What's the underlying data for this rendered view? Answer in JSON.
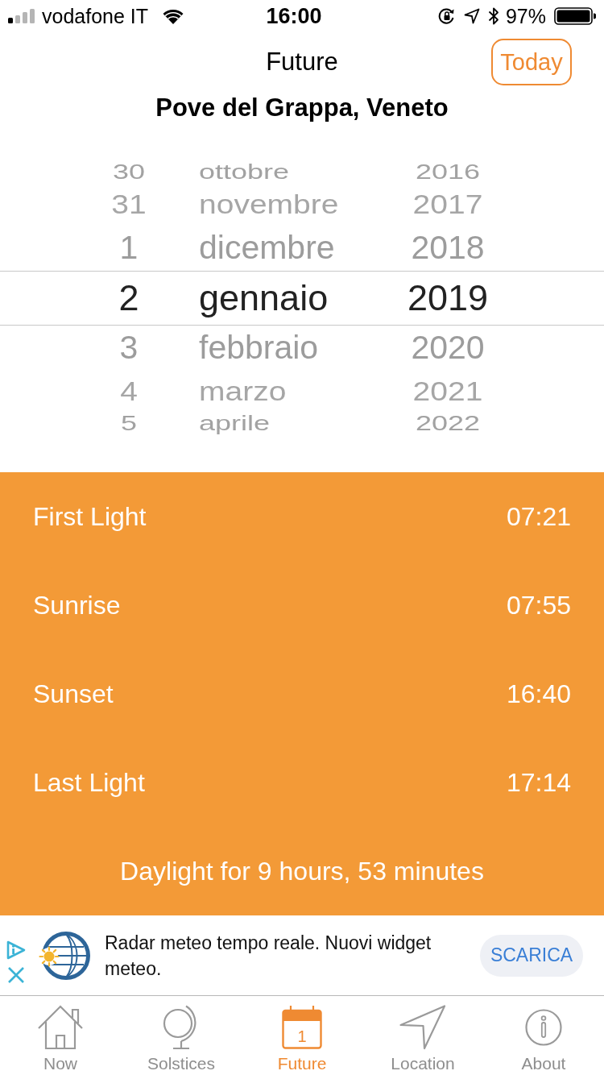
{
  "status_bar": {
    "carrier": "vodafone IT",
    "time": "16:00",
    "battery_percent": "97%"
  },
  "nav": {
    "title": "Future",
    "today_button": "Today"
  },
  "location": "Pove del Grappa, Veneto",
  "date_picker": {
    "rows": [
      {
        "day": "30",
        "month": "ottobre",
        "year": "2016",
        "selected": false
      },
      {
        "day": "31",
        "month": "novembre",
        "year": "2017",
        "selected": false
      },
      {
        "day": "1",
        "month": "dicembre",
        "year": "2018",
        "selected": false
      },
      {
        "day": "2",
        "month": "gennaio",
        "year": "2019",
        "selected": true
      },
      {
        "day": "3",
        "month": "febbraio",
        "year": "2020",
        "selected": false
      },
      {
        "day": "4",
        "month": "marzo",
        "year": "2021",
        "selected": false
      },
      {
        "day": "5",
        "month": "aprile",
        "year": "2022",
        "selected": false
      }
    ]
  },
  "sun_times": [
    {
      "label": "First Light",
      "time": "07:21"
    },
    {
      "label": "Sunrise",
      "time": "07:55"
    },
    {
      "label": "Sunset",
      "time": "16:40"
    },
    {
      "label": "Last Light",
      "time": "17:14"
    }
  ],
  "daylight": "Daylight for 9 hours, 53 minutes",
  "ad": {
    "text": "Radar meteo tempo reale. Nuovi widget meteo.",
    "button": "SCARICA"
  },
  "tab_bar": [
    {
      "label": "Now",
      "selected": false
    },
    {
      "label": "Solstices",
      "selected": false
    },
    {
      "label": "Future",
      "selected": true,
      "icon_text": "1"
    },
    {
      "label": "Location",
      "selected": false
    },
    {
      "label": "About",
      "selected": false
    }
  ]
}
